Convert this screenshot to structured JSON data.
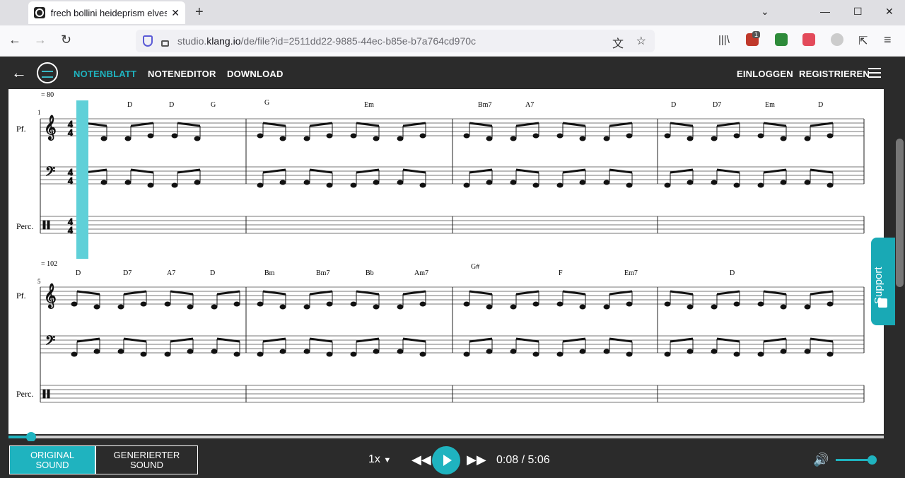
{
  "browser": {
    "tab_title": "frech bollini heideprism elves ai",
    "new_tab": "+",
    "url_prefix": "studio.",
    "url_domain": "klang.io",
    "url_path": "/de/file?id=2511dd22-9885-44ec-b85e-b7a764cd970c",
    "ext_badge": "1"
  },
  "app": {
    "nav": {
      "sheet": "NOTENBLATT",
      "editor": "NOTENEDITOR",
      "download": "DOWNLOAD",
      "login": "EINLOGGEN",
      "register": "REGISTRIEREN"
    },
    "support": "Support",
    "accent_color": "#1fb3bf"
  },
  "score": {
    "system1": {
      "tempo": "= 80",
      "measure_number": "1",
      "time_sig": "4/4",
      "chords": [
        "D",
        "D",
        "G",
        "G",
        "Em",
        "Bm7",
        "A7",
        "D",
        "D7",
        "Em",
        "D"
      ],
      "instruments": [
        "Pf.",
        "Perc."
      ]
    },
    "system2": {
      "tempo": "= 102",
      "measure_number": "5",
      "chords": [
        "D",
        "D7",
        "A7",
        "D",
        "Bm",
        "Bm7",
        "Bb",
        "Am7",
        "G#",
        "F",
        "Em7",
        "D"
      ],
      "instruments": [
        "Pf.",
        "Perc."
      ]
    }
  },
  "player": {
    "progress": 0.026,
    "original_sound_l1": "ORIGINAL",
    "original_sound_l2": "SOUND",
    "generated_sound_l1": "GENERIERTER",
    "generated_sound_l2": "SOUND",
    "speed": "1x",
    "time_current": "0:08",
    "time_separator": "/",
    "time_total": "5:06",
    "volume": 0.9
  }
}
